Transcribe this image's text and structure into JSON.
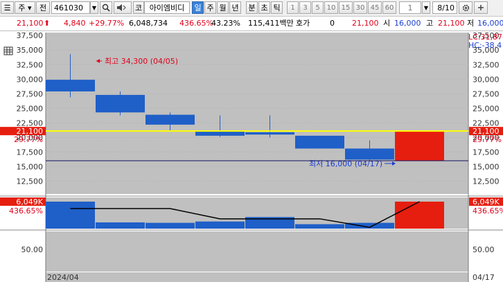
{
  "toolbar": {
    "market_select": "주",
    "all_button": "전",
    "code_input": "461030",
    "code_dropdown": "▼",
    "search_icon": "search-icon",
    "sound_icon": "speaker-icon",
    "name_prefix": "코",
    "stock_name": "아이엠비디",
    "periods": [
      "일",
      "주",
      "월",
      "년",
      "분",
      "초",
      "틱"
    ],
    "selected_period": "일",
    "intervals": [
      "1",
      "3",
      "5",
      "10",
      "15",
      "30",
      "45",
      "60"
    ],
    "count_value": "1",
    "page_display": "8/10",
    "settings_icon": "gear-icon",
    "expand_icon": "plus-icon"
  },
  "quote": {
    "price": "21,100",
    "arrow": "⬆",
    "change": "4,840",
    "change_rate": "+29.77%",
    "volume": "6,048,734",
    "volume_rate": "436.65%",
    "ratio": "43.23%",
    "amount": "115,411백만",
    "hoga_label": "호가",
    "hoga_value": "0",
    "hoga_price": "21,100",
    "open_label": "시",
    "open_value": "16,000",
    "high_label": "고",
    "high_value": "21,100",
    "low_label": "저",
    "low_value": "16,000"
  },
  "chart_data": {
    "type": "candlestick",
    "y_ticks": [
      "37,500",
      "35,000",
      "32,500",
      "30,000",
      "27,500",
      "25,000",
      "22,500",
      "20,000",
      "17,500",
      "15,000",
      "12,500"
    ],
    "ylim": [
      10300,
      38000
    ],
    "candles": [
      {
        "open": 29900,
        "close": 27900,
        "high": 34300,
        "low": 26900
      },
      {
        "open": 27300,
        "close": 24300,
        "high": 27900,
        "low": 23800
      },
      {
        "open": 23900,
        "close": 22200,
        "high": 24300,
        "low": 21200
      },
      {
        "open": 21000,
        "close": 20300,
        "high": 23800,
        "low": 20100
      },
      {
        "open": 20900,
        "close": 20500,
        "high": 23800,
        "low": 20000
      },
      {
        "open": 20300,
        "close": 18100,
        "high": 20300,
        "low": 18100
      },
      {
        "open": 18100,
        "close": 16200,
        "high": 19500,
        "low": 16000
      },
      {
        "open": 16000,
        "close": 21100,
        "high": 21100,
        "low": 16000
      }
    ],
    "current_price_label": "21,100",
    "current_rate_label": "29.77%",
    "max_annotation": "최고 34,300 (04/05)",
    "min_annotation": "최저 16,000 (04/17)",
    "lc_label": "LC:31,87",
    "hc_label": "HC:-38,4",
    "volume": {
      "max_label": "6,049K",
      "rate_label": "436.65%",
      "values": [
        6049,
        1400,
        1300,
        1600,
        2600,
        1000,
        1300,
        6049
      ],
      "line_values": [
        4500,
        4500,
        4500,
        2200,
        2200,
        2200,
        300,
        6049
      ]
    },
    "lower_tick": "50.00",
    "x_start_label": "2024/04",
    "x_end_label": "04/17",
    "colors": {
      "up": "#e61e10",
      "down": "#1f5fc8",
      "price_line": "#ffff00",
      "bg": "#c0c0c0"
    }
  }
}
